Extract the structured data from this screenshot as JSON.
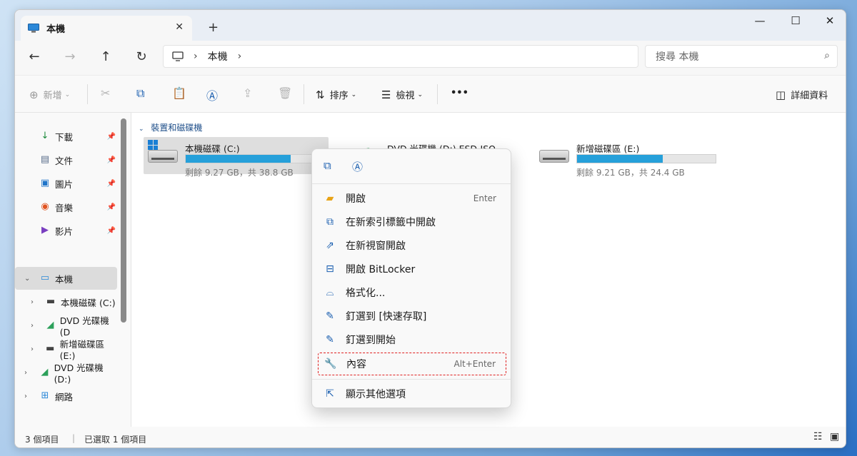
{
  "window": {
    "tab_title": "本機",
    "controls": {
      "minimize": "—",
      "maximize": "☐",
      "close": "✕"
    },
    "new_tab": "+",
    "tab_close": "✕"
  },
  "nav": {
    "back": "←",
    "forward": "→",
    "up": "↑",
    "refresh": "↻",
    "breadcrumb_sep": "›",
    "breadcrumb": [
      "本機"
    ],
    "breadcrumb_trailing": "›",
    "search_placeholder": "搜尋 本機"
  },
  "commands": {
    "new_label": "新增",
    "sort_label": "排序",
    "view_label": "檢視",
    "more_label": "•••",
    "details_label": "詳細資料"
  },
  "sidebar": {
    "quick": [
      {
        "label": "下載",
        "icon": "download-icon"
      },
      {
        "label": "文件",
        "icon": "documents-icon"
      },
      {
        "label": "圖片",
        "icon": "pictures-icon"
      },
      {
        "label": "音樂",
        "icon": "music-icon"
      },
      {
        "label": "影片",
        "icon": "videos-icon"
      }
    ],
    "this_pc": "本機",
    "children": [
      {
        "label": "本機磁碟 (C:)"
      },
      {
        "label": "DVD 光碟機 (D"
      },
      {
        "label": "新增磁碟區 (E:)"
      }
    ],
    "dvd_root": "DVD 光碟機 (D:)",
    "network": "網路"
  },
  "content": {
    "group_header": "裝置和磁碟機",
    "drives": [
      {
        "name": "本機磁碟 (C:)",
        "free": "剩餘 9.27 GB，共 38.8 GB",
        "used_fraction": 0.76
      },
      {
        "name": "DVD 光碟機 (D:) ESD-ISO"
      },
      {
        "name": "新增磁碟區 (E:)",
        "free": "剩餘 9.21 GB，共 24.4 GB",
        "used_fraction": 0.62
      }
    ]
  },
  "context_menu": {
    "items": [
      {
        "label": "開啟",
        "accel": "Enter",
        "icon": "folder-open-icon"
      },
      {
        "label": "在新索引標籤中開啟",
        "accel": "",
        "icon": "new-tab-icon"
      },
      {
        "label": "在新視窗開啟",
        "accel": "",
        "icon": "new-window-icon"
      },
      {
        "label": "開啟 BitLocker",
        "accel": "",
        "icon": "bitlocker-icon"
      },
      {
        "label": "格式化...",
        "accel": "",
        "icon": "format-icon"
      },
      {
        "label": "釘選到 [快速存取]",
        "accel": "",
        "icon": "pin-icon"
      },
      {
        "label": "釘選到開始",
        "accel": "",
        "icon": "pin-icon"
      },
      {
        "label": "內容",
        "accel": "Alt+Enter",
        "icon": "wrench-icon"
      },
      {
        "label": "顯示其他選項",
        "accel": "",
        "icon": "more-options-icon"
      }
    ]
  },
  "status": {
    "item_count": "3 個項目",
    "selected": "已選取 1 個項目"
  },
  "colors": {
    "accent": "#26a0da",
    "highlight_border": "#e02020"
  }
}
